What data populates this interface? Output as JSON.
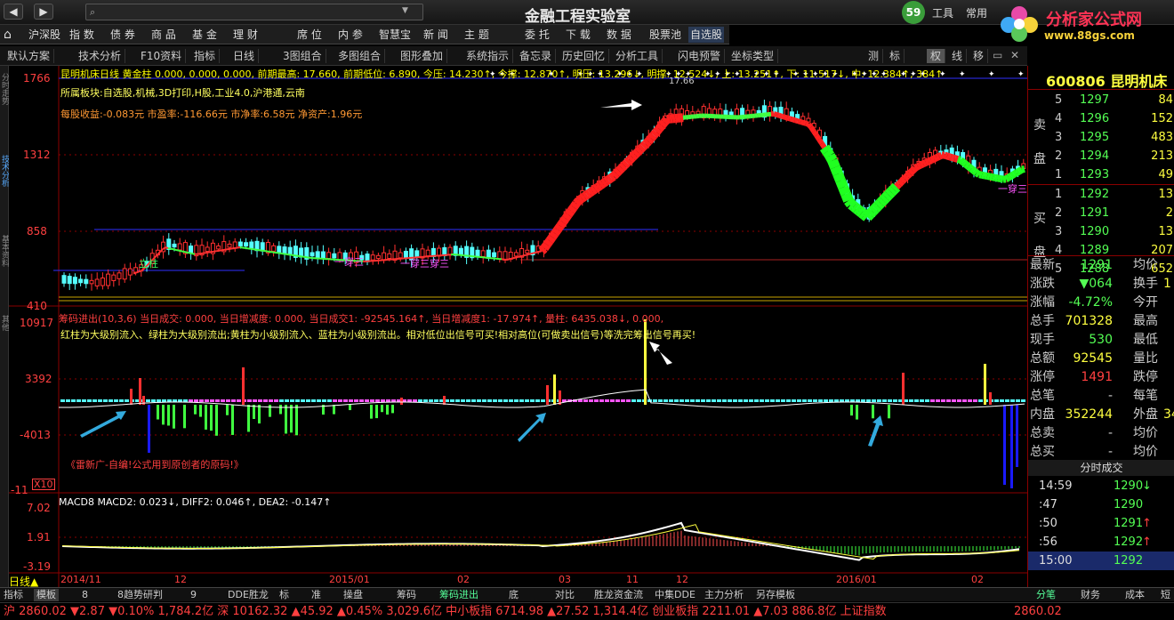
{
  "window": {
    "title": "金融工程实验室",
    "search_placeholder": "",
    "top_right": {
      "badge": "59",
      "tools": "工具",
      "common": "常用"
    }
  },
  "logo": {
    "line1": "分析家公式网",
    "line2": "www.88gs.com"
  },
  "menu": {
    "items": [
      "沪深股",
      "指 数",
      "债 券",
      "商 品",
      "基 金",
      "理 财",
      "席 位",
      "内 参",
      "智慧宝",
      "新 闻",
      "主 题",
      "委 托",
      "下 载",
      "数 据",
      "股票池",
      "自选股"
    ]
  },
  "toolbar": {
    "items": [
      "默认方案",
      "技术分析",
      "F10资料",
      "指标",
      "日线",
      "3图组合",
      "多图组合",
      "图形叠加",
      "系统指示",
      "备忘录",
      "历史回忆",
      "分析工具",
      "闪电预警",
      "坐标类型"
    ],
    "right_items": [
      "测",
      "标",
      "权",
      "线",
      "移"
    ]
  },
  "left_tabs": [
    "分时走势",
    "技术分析",
    "基本资料",
    "其他"
  ],
  "main_panel": {
    "header": "昆明机床日线 黄金柱 0.000, 0.000, 0.000, 前期最高: 17.660, 前期低位: 6.890, 今压: 14.230↑, 今撑: 12.870↑, 明压: 13.296↓, 明撑: 12.524↓, 上: 13.251↑, 下: 11.517↓, 中: 12.384↑, 384↑",
    "info1": "所属板块:自选股,机械,3D打印,H股,工业4.0,沪港通,云南",
    "info2": "每股收益:-0.083元 市盈率:-116.66元 市净率:6.58元 净资产:1.96元",
    "y_ticks": [
      "1766",
      "1312",
      "858",
      "410"
    ],
    "peak_label": "17.66",
    "annotations": [
      "立柱",
      "一穿三",
      "一穿三穿三",
      "一穿三"
    ]
  },
  "chips_panel": {
    "header": "筹码进出(10,3,6) 当日成交: 0.000, 当日增减度: 0.000, 当日成交1: -92545.164↑, 当日增减度1: -17.974↑, 量柱: 6435.038↓, 0.000,",
    "desc": "红柱为大级别流入、绿柱为大级别流出;黄柱为小级别流入、蓝柱为小级别流出。相对低位出信号可买!相对高位(可做卖出信号)等洗完筹出信号再买!",
    "credit": "《雷新广-自编!公式用到原创者的原码!》",
    "y_ticks": [
      "10917",
      "3392",
      "-4013",
      "-11"
    ],
    "scale": "X10"
  },
  "macd_panel": {
    "header": "MACD8 MACD2: 0.023↓, DIFF2: 0.046↑, DEA2: -0.147↑",
    "y_ticks": [
      "7.02",
      "1.91",
      "-3.19"
    ]
  },
  "x_axis": [
    "2014/11",
    "12",
    "2015/01",
    "02",
    "03",
    "11",
    "12",
    "2016/01",
    "02"
  ],
  "period": "日线▲",
  "bottom_tabs": [
    "指标",
    "模板",
    "8",
    "8趋势研判",
    "9",
    "DDE胜龙",
    "标",
    "准",
    "操盘",
    "筹码",
    "筹码进出",
    "底",
    "对比",
    "胜龙资金流",
    "中集DDE",
    "主力分析",
    "另存模板"
  ],
  "quote": {
    "code": "600806",
    "name": "昆明机床",
    "sell": [
      {
        "label": "5",
        "price": "1297",
        "vol": "84"
      },
      {
        "label": "4",
        "price": "1296",
        "vol": "152"
      },
      {
        "label": "3",
        "price": "1295",
        "vol": "483"
      },
      {
        "label": "2",
        "price": "1294",
        "vol": "213"
      },
      {
        "label": "1",
        "price": "1293",
        "vol": "49"
      }
    ],
    "buy": [
      {
        "label": "1",
        "price": "1292",
        "vol": "13"
      },
      {
        "label": "2",
        "price": "1291",
        "vol": "2"
      },
      {
        "label": "3",
        "price": "1290",
        "vol": "13"
      },
      {
        "label": "4",
        "price": "1289",
        "vol": "207"
      },
      {
        "label": "5",
        "price": "1288",
        "vol": "652"
      }
    ],
    "sell_label": "卖 盘",
    "buy_label": "买 盘",
    "stats": [
      {
        "k": "最新",
        "v": "1291",
        "k2": "均价",
        "v2": ""
      },
      {
        "k": "涨跌",
        "v": "▼064",
        "k2": "换手",
        "v2": "1"
      },
      {
        "k": "涨幅",
        "v": "-4.72%",
        "k2": "今开",
        "v2": ""
      },
      {
        "k": "总手",
        "v": "701328",
        "k2": "最高",
        "v2": ""
      },
      {
        "k": "现手",
        "v": "530",
        "k2": "最低",
        "v2": ""
      },
      {
        "k": "总额",
        "v": "92545",
        "k2": "量比",
        "v2": ""
      },
      {
        "k": "涨停",
        "v": "1491",
        "k2": "跌停",
        "v2": ""
      },
      {
        "k": "总笔",
        "v": "-",
        "k2": "每笔",
        "v2": ""
      },
      {
        "k": "内盘",
        "v": "352244",
        "k2": "外盘",
        "v2": "34"
      },
      {
        "k": "总卖",
        "v": "-",
        "k2": "均价",
        "v2": ""
      },
      {
        "k": "总买",
        "v": "-",
        "k2": "均价",
        "v2": ""
      }
    ],
    "ticks_title": "分时成交",
    "ticks": [
      {
        "t": "14:59",
        "p": "1290",
        "a": "↓"
      },
      {
        "t": ":47",
        "p": "1290",
        "a": ""
      },
      {
        "t": ":50",
        "p": "1291",
        "a": "↑"
      },
      {
        "t": ":56",
        "p": "1292",
        "a": "↑"
      },
      {
        "t": "15:00",
        "p": "1292",
        "a": ""
      }
    ],
    "tabs": [
      "分笔",
      "财务",
      "成本",
      "短"
    ]
  },
  "status": {
    "text": "沪 2860.02 ▼2.87 ▼0.10% 1,784.2亿 深 10162.32 ▲45.92 ▲0.45% 3,029.6亿 中小板指 6714.98 ▲27.52 1,314.4亿 创业板指 2211.01 ▲7.03 886.8亿 上证指数",
    "right": "2860.02"
  },
  "colors": {
    "up": "#ff3030",
    "down": "#54ffff",
    "accent": "#ffff00"
  },
  "chart_data": {
    "type": "candlestick",
    "symbol": "600806",
    "ylim": [
      4.1,
      17.66
    ],
    "peak": 17.66,
    "low": 6.89
  }
}
